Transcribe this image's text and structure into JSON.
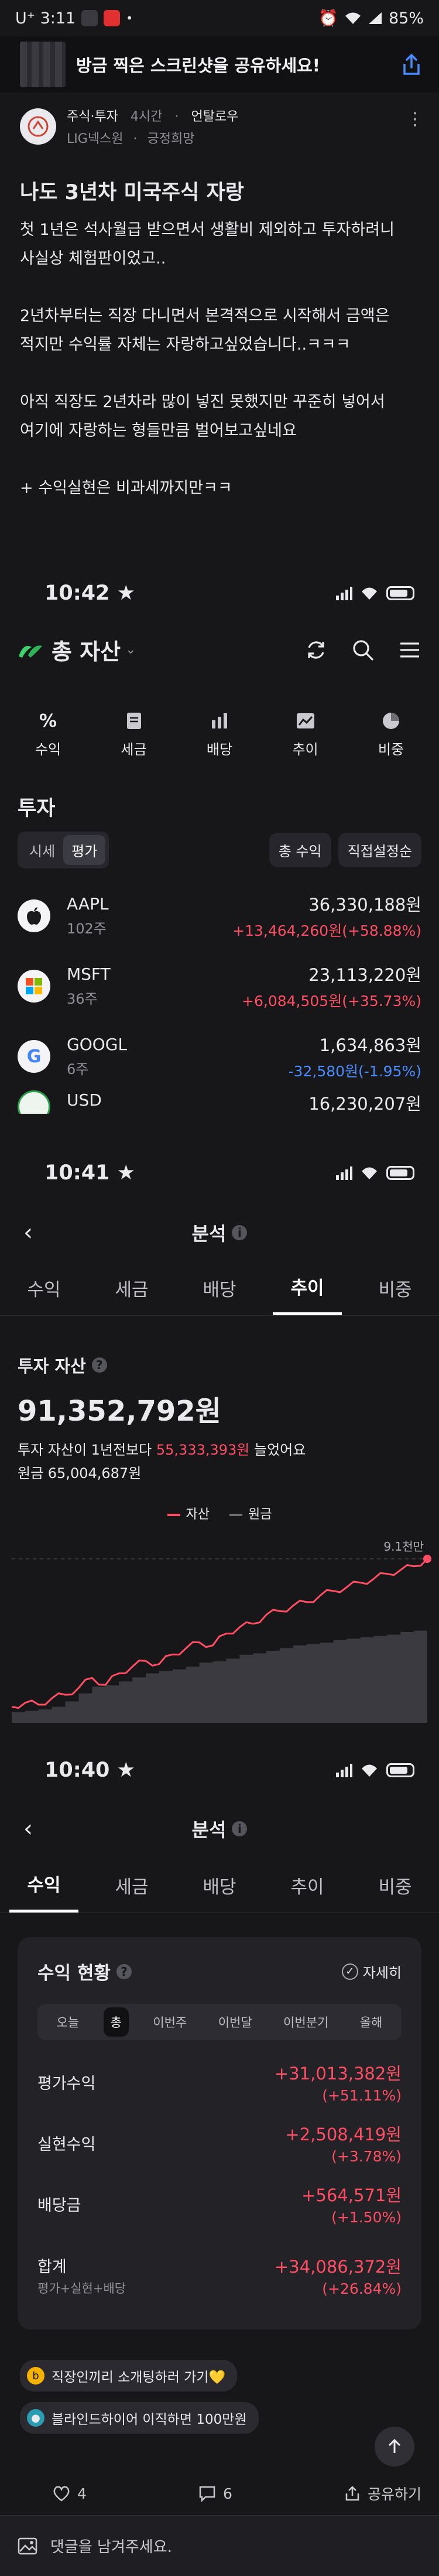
{
  "outer_status": {
    "carrier_time": "U⁺ 3:11",
    "battery": "85%"
  },
  "share_banner": {
    "text": "방금 찍은 스크린샷을 공유하세요!"
  },
  "post": {
    "category": "주식·투자",
    "age": "4시간",
    "author": "언탈로우",
    "company": "LIG넥스원",
    "author_tag": "긍정희망",
    "title": "나도 3년차 미국주식 자랑",
    "body": [
      "첫 1년은 석사월급 받으면서 생활비 제외하고 투자하려니",
      "사실상 체험판이었고..",
      "",
      "2년차부터는 직장 다니면서 본격적으로 시작해서 금액은",
      "적지만 수익률 자체는 자랑하고싶었습니다..ㅋㅋㅋ",
      "",
      "아직 직장도 2년차라 많이 넣진 못했지만 꾸준히 넣어서",
      "여기에 자랑하는 형들만큼 벌어보고싶네요",
      "",
      "+ 수익실현은 비과세까지만ㅋㅋ"
    ]
  },
  "panel1": {
    "time": "10:42",
    "title": "총 자산",
    "tabs": [
      {
        "label": "수익",
        "icon": "percent-icon"
      },
      {
        "label": "세금",
        "icon": "receipt-icon"
      },
      {
        "label": "배당",
        "icon": "bar-chart-icon"
      },
      {
        "label": "추이",
        "icon": "trend-icon"
      },
      {
        "label": "비중",
        "icon": "pie-icon"
      }
    ],
    "section_title": "투자",
    "segment": {
      "a": "시세",
      "b": "평가"
    },
    "chips": {
      "a": "총 수익",
      "b": "직접설정순"
    },
    "stocks": [
      {
        "name": "AAPL",
        "qty": "102주",
        "value": "36,330,188원",
        "change": "+13,464,260원(+58.88%)"
      },
      {
        "name": "MSFT",
        "qty": "36주",
        "value": "23,113,220원",
        "change": "+6,084,505원(+35.73%)"
      },
      {
        "name": "GOOGL",
        "qty": "6주",
        "value": "1,634,863원",
        "change": "-32,580원(-1.95%)"
      },
      {
        "name": "USD",
        "qty": "",
        "value": "16,230,207원",
        "change": ""
      }
    ]
  },
  "panel2": {
    "time": "10:41",
    "header": "분석",
    "tabs": [
      "수익",
      "세금",
      "배당",
      "추이",
      "비중"
    ],
    "active_tab": "추이",
    "asset_label": "투자 자산",
    "asset_value": "91,352,792원",
    "desc_prefix": "투자 자산이 1년전보다 ",
    "desc_amount": "55,333,393원",
    "desc_suffix": " 늘었어요",
    "principal": "원금 65,004,687원",
    "legend": {
      "asset": "자산",
      "principal": "원금"
    },
    "chart_data": {
      "type": "area",
      "series": [
        {
          "name": "자산",
          "values": [
            36.0,
            37.5,
            36.8,
            39.2,
            40.5,
            43.1,
            46.8,
            44.2,
            48.5,
            51.0,
            53.2,
            52.0,
            55.6,
            57.9,
            60.1,
            59.0,
            63.4,
            65.8,
            67.1,
            70.5,
            71.8,
            73.9,
            75.2,
            77.6,
            79.4,
            80.8,
            82.5,
            83.9,
            85.8,
            87.2,
            88.6,
            91.4
          ]
        },
        {
          "name": "원금",
          "values": [
            34.0,
            34.5,
            35.0,
            36.0,
            38.0,
            41.0,
            43.5,
            44.0,
            45.5,
            47.0,
            48.5,
            49.5,
            50.0,
            51.0,
            52.5,
            53.0,
            54.0,
            55.5,
            56.0,
            57.0,
            58.0,
            59.0,
            59.5,
            60.0,
            61.0,
            61.5,
            62.0,
            62.5,
            63.0,
            64.0,
            64.5,
            65.0
          ]
        }
      ],
      "max_label": "9.1천만"
    }
  },
  "panel3": {
    "time": "10:40",
    "header": "분석",
    "tabs": [
      "수익",
      "세금",
      "배당",
      "추이",
      "비중"
    ],
    "active_tab": "수익",
    "card_title": "수익 현황",
    "detail": "자세히",
    "periods": [
      "오늘",
      "총",
      "이번주",
      "이번달",
      "이번분기",
      "올해"
    ],
    "active_period": "총",
    "rows": [
      {
        "label": "평가수익",
        "value": "+31,013,382원",
        "pct": "(+51.11%)"
      },
      {
        "label": "실현수익",
        "value": "+2,508,419원",
        "pct": "(+3.78%)"
      },
      {
        "label": "배당금",
        "value": "+564,571원",
        "pct": "(+1.50%)"
      },
      {
        "label": "합계",
        "sublabel": "평가+실현+배당",
        "value": "+34,086,372원",
        "pct": "(+26.84%)"
      }
    ]
  },
  "links": [
    {
      "text": "직장인끼리 소개팅하러 가기💛",
      "icon_color": "#f5b300"
    },
    {
      "text": "블라인드하이어 이직하면 100만원",
      "icon_color": "#2a9db3"
    }
  ],
  "actions": {
    "likes": "4",
    "comments": "6",
    "share": "공유하기"
  },
  "comment_placeholder": "댓글을 남겨주세요.",
  "colors": {
    "accent_red": "#ff4d63",
    "accent_blue": "#4a8cff",
    "bg": "#17171a"
  }
}
